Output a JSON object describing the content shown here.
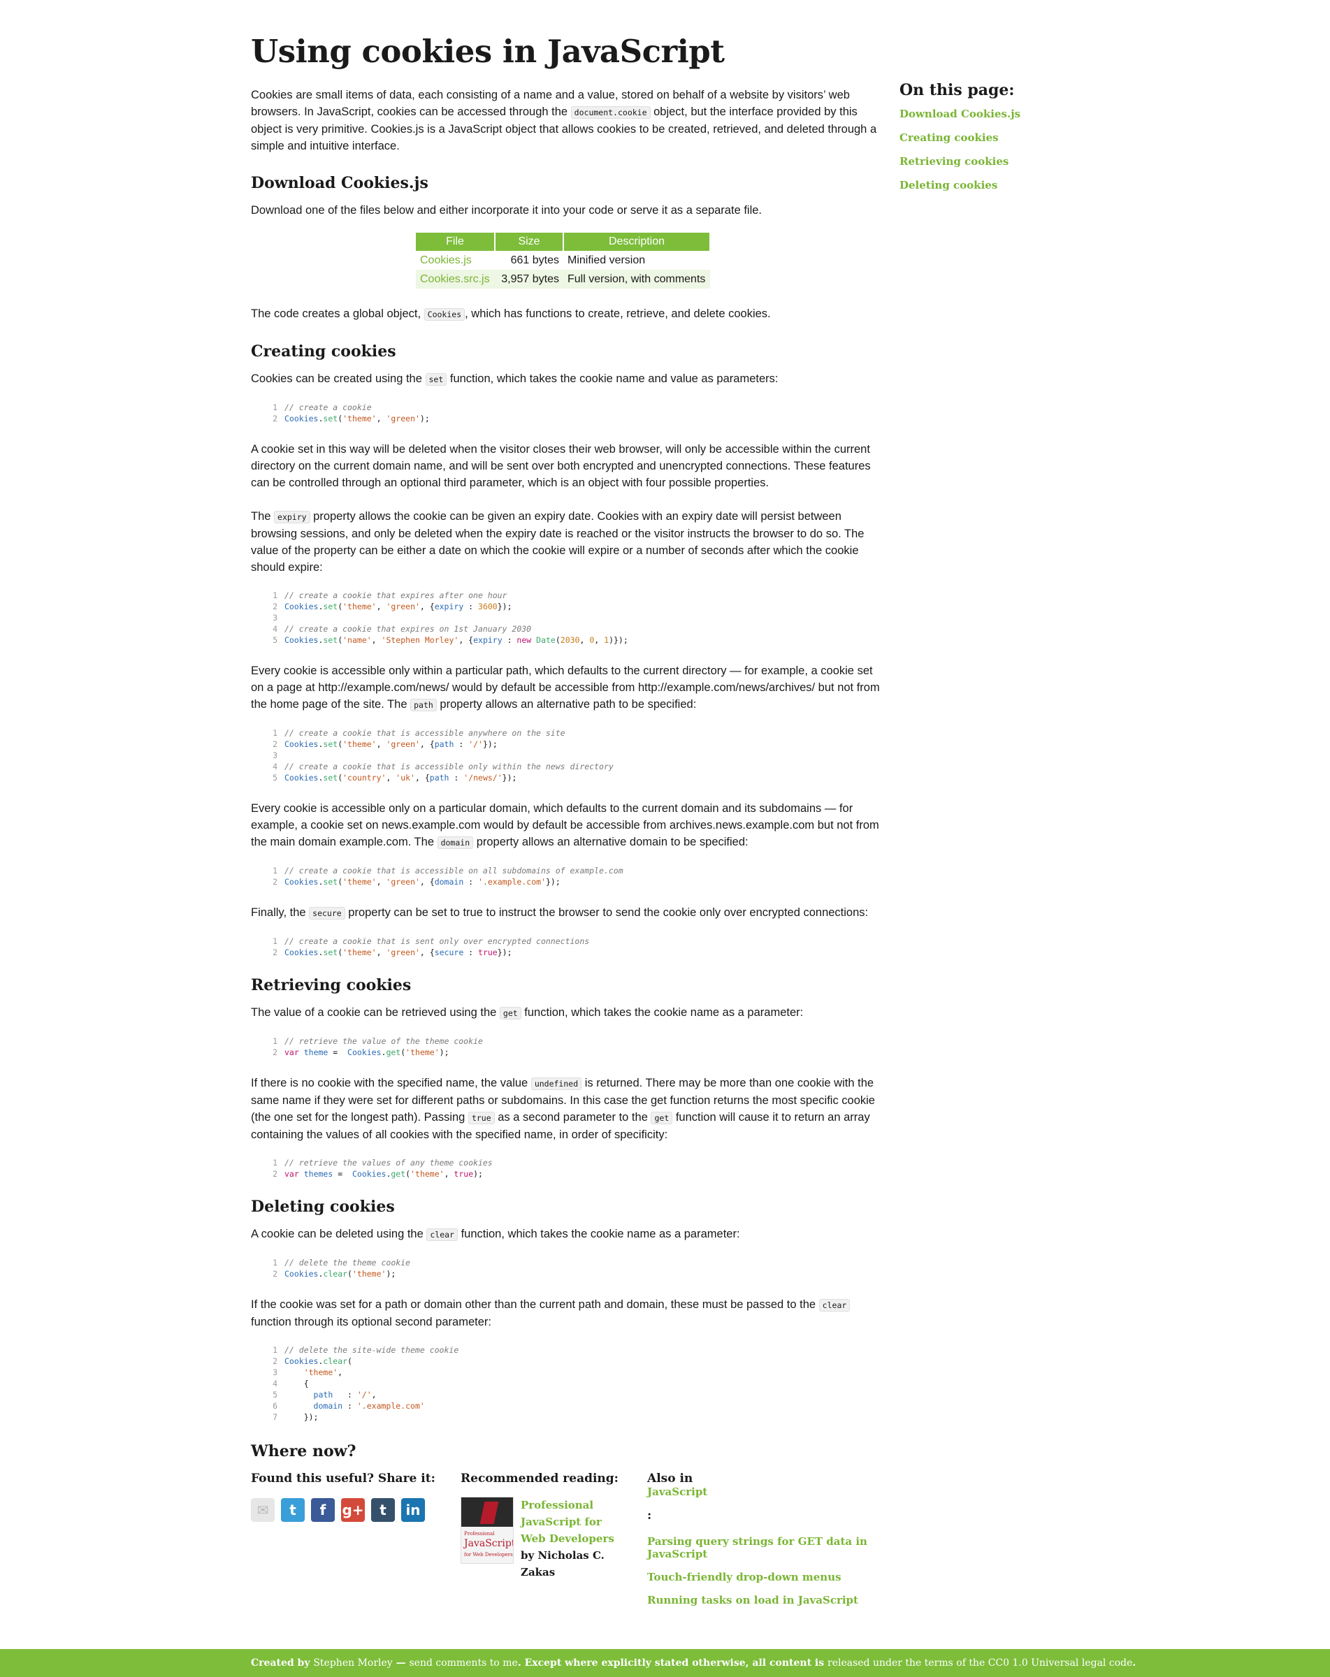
{
  "title": "Using cookies in JavaScript",
  "intro": {
    "t1": "Cookies are small items of data, each consisting of a name and a value, stored on behalf of a website by visitors’ web browsers. In JavaScript, cookies can be accessed through the ",
    "c1": "document.cookie",
    "t2": " object, but the interface provided by this object is very primitive. Cookies.js is a JavaScript object that allows cookies to be created, retrieved, and deleted through a simple and intuitive interface."
  },
  "download": {
    "heading": "Download Cookies.js",
    "text": "Download one of the files below and either incorporate it into your code or serve it as a separate file.",
    "headers": [
      "File",
      "Size",
      "Description"
    ],
    "rows": [
      {
        "file": "Cookies.js",
        "size": "661 bytes",
        "desc": "Minified version"
      },
      {
        "file": "Cookies.src.js",
        "size": "3,957 bytes",
        "desc": "Full version, with comments"
      }
    ],
    "after_t1": "The code creates a global object, ",
    "after_c1": "Cookies",
    "after_t2": ", which has functions to create, retrieve, and delete cookies."
  },
  "creating": {
    "heading": "Creating cookies",
    "p1_t1": "Cookies can be created using the ",
    "p1_c1": "set",
    "p1_t2": " function, which takes the cookie name and value as parameters:",
    "p2": "A cookie set in this way will be deleted when the visitor closes their web browser, will only be accessible within the current directory on the current domain name, and will be sent over both encrypted and unencrypted connections. These features can be controlled through an optional third parameter, which is an object with four possible properties.",
    "p3_t1": "The ",
    "p3_c1": "expiry",
    "p3_t2": " property allows the cookie can be given an expiry date. Cookies with an expiry date will persist between browsing sessions, and only be deleted when the expiry date is reached or the visitor instructs the browser to do so. The value of the property can be either a date on which the cookie will expire or a number of seconds after which the cookie should expire:",
    "p4_t1": "Every cookie is accessible only within a particular path, which defaults to the current directory — for example, a cookie set on a page at http://example.com/news/ would by default be accessible from http://example.com/news/archives/ but not from the home page of the site. The ",
    "p4_c1": "path",
    "p4_t2": " property allows an alternative path to be specified:",
    "p5_t1": "Every cookie is accessible only on a particular domain, which defaults to the current domain and its subdomains — for example, a cookie set on news.example.com would by default be accessible from archives.news.example.com but not from the main domain example.com. The ",
    "p5_c1": "domain",
    "p5_t2": " property allows an alternative domain to be specified:",
    "p6_t1": "Finally, the ",
    "p6_c1": "secure",
    "p6_t2": " property can be set to true to instruct the browser to send the cookie only over encrypted connections:"
  },
  "retrieving": {
    "heading": "Retrieving cookies",
    "p1_t1": "The value of a cookie can be retrieved using the ",
    "p1_c1": "get",
    "p1_t2": " function, which takes the cookie name as a parameter:",
    "p2_t1": "If there is no cookie with the specified name, the value ",
    "p2_c1": "undefined",
    "p2_t2": " is returned. There may be more than one cookie with the same name if they were set for different paths or subdomains. In this case the get function returns the most specific cookie (the one set for the longest path). Passing ",
    "p2_c2": "true",
    "p2_t3": " as a second parameter to the ",
    "p2_c3": "get",
    "p2_t4": " function will cause it to return an array containing the values of all cookies with the specified name, in order of specificity:"
  },
  "deleting": {
    "heading": "Deleting cookies",
    "p1_t1": "A cookie can be deleted using the ",
    "p1_c1": "clear",
    "p1_t2": " function, which takes the cookie name as a parameter:",
    "p2_t1": "If the cookie was set for a path or domain other than the current path and domain, these must be passed to the ",
    "p2_c1": "clear",
    "p2_t2": " function through its optional second parameter:"
  },
  "sidebar": {
    "heading": "On this page:",
    "links": [
      "Download Cookies.js",
      "Creating cookies",
      "Retrieving cookies",
      "Deleting cookies"
    ]
  },
  "where_now": {
    "heading": "Where now?",
    "share_heading": "Found this useful? Share it:",
    "share_icons": [
      {
        "name": "email-icon",
        "glyph": "✉",
        "color": "#e6e6e6"
      },
      {
        "name": "twitter-icon",
        "glyph": "t",
        "color": "#3a9ed8"
      },
      {
        "name": "facebook-icon",
        "glyph": "f",
        "color": "#3a5a98"
      },
      {
        "name": "google-plus-icon",
        "glyph": "g+",
        "color": "#d44a3a"
      },
      {
        "name": "tumblr-icon",
        "glyph": "t",
        "color": "#35506b"
      },
      {
        "name": "linkedin-icon",
        "glyph": "in",
        "color": "#1a75b0"
      }
    ],
    "reading_heading": "Recommended reading:",
    "book_title": "Professional JavaScript for Web Developers",
    "book_by": " by ",
    "book_author": "Nicholas C. Zakas",
    "book_cover_top": "Professional",
    "book_cover_title": "JavaScript",
    "book_cover_sub": "for Web Developers",
    "also_prefix": "Also in ",
    "also_topic": "JavaScript",
    "also_suffix": ":",
    "also_links": [
      "Parsing query strings for GET data in JavaScript",
      "Touch-friendly drop-down menus",
      "Running tasks on load in JavaScript"
    ]
  },
  "footer": {
    "created_by": "Created by ",
    "author": "Stephen Morley",
    "dash": " — ",
    "send_comments": "send comments to me",
    "rest1": ". Except where explicitly stated otherwise, all content is ",
    "released": "released under the terms of the CC0 1.0 Universal legal code",
    "rest2": "."
  },
  "colors": {
    "accent": "#7dbd3a",
    "link": "#7ab534"
  }
}
